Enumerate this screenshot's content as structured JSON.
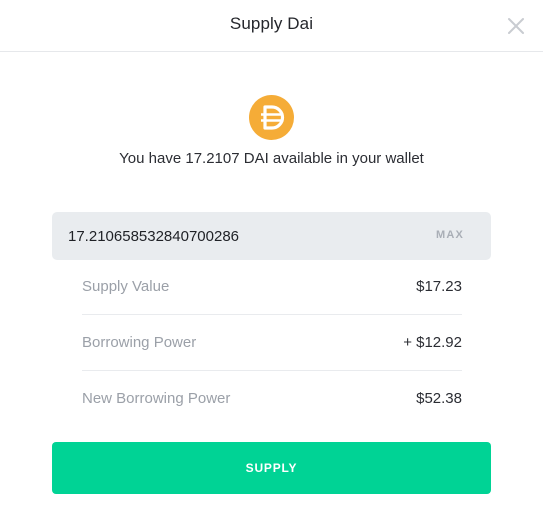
{
  "header": {
    "title": "Supply Dai",
    "close_icon": "close-icon"
  },
  "token": {
    "icon": "dai-token-icon",
    "icon_color": "#f5ac37",
    "wallet_text": "You have 17.2107 DAI available in your wallet"
  },
  "amount": {
    "value": "17.210658532840700286",
    "max_label": "MAX"
  },
  "summary": [
    {
      "label": "Supply Value",
      "value": "$17.23"
    },
    {
      "label": "Borrowing Power",
      "value": "+ $12.92"
    },
    {
      "label": "New Borrowing Power",
      "value": "$52.38"
    }
  ],
  "actions": {
    "supply_label": "SUPPLY",
    "supply_color": "#00d395"
  }
}
